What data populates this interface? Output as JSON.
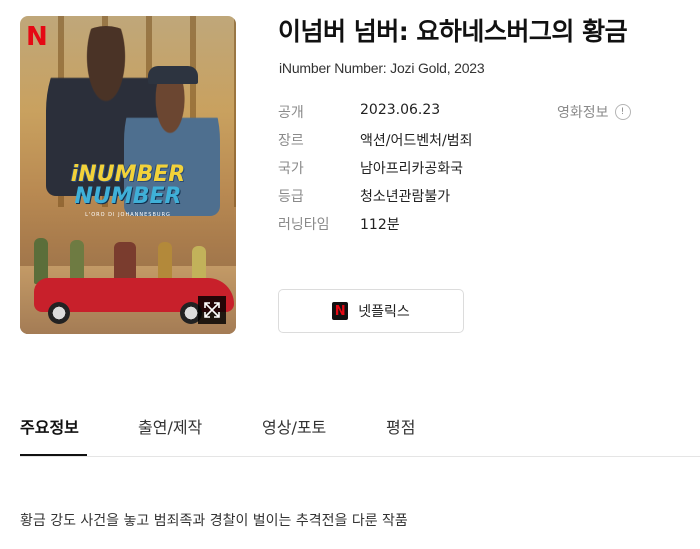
{
  "poster": {
    "title_line1": "iNUMBER",
    "title_line2": "NUMBER",
    "tagline": "L'ORO DI JOHANNESBURG",
    "brand": "N"
  },
  "header": {
    "title": "이넘버 넘버: 요하네스버그의 황금",
    "original_title": "iNumber Number: Jozi Gold",
    "year": "2023"
  },
  "info": {
    "rows": [
      {
        "label": "공개",
        "value": "2023.06.23"
      },
      {
        "label": "장르",
        "value": "액션/어드벤처/범죄"
      },
      {
        "label": "국가",
        "value": "남아프리카공화국"
      },
      {
        "label": "등급",
        "value": "청소년관람불가"
      },
      {
        "label": "러닝타임",
        "value": "112분"
      }
    ],
    "more_label": "영화정보",
    "more_icon": "!"
  },
  "ott": {
    "logo": "N",
    "label": "넷플릭스"
  },
  "tabs": [
    {
      "label": "주요정보",
      "active": true
    },
    {
      "label": "출연/제작",
      "active": false
    },
    {
      "label": "영상/포토",
      "active": false
    },
    {
      "label": "평점",
      "active": false
    }
  ],
  "description": "황금 강도 사건을 놓고 범죄족과 경찰이 벌이는 추격전을 다룬 작품",
  "colors": {
    "netflix_red": "#e50914",
    "tab_active": "#111111",
    "label_gray": "#8a8a8a"
  }
}
